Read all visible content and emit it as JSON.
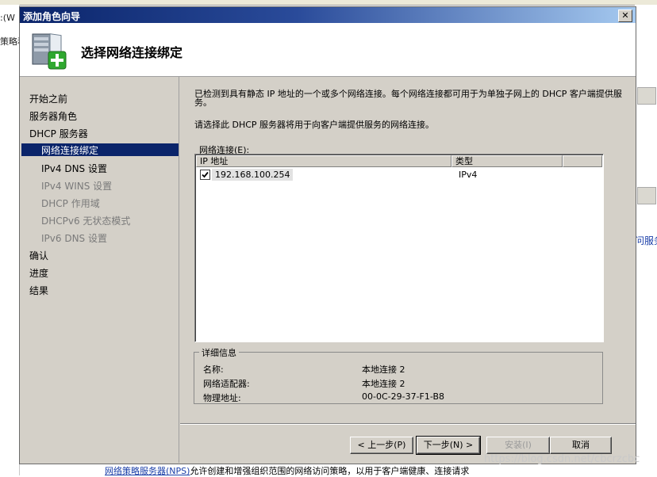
{
  "background": {
    "left_fragments": [
      ":(W",
      "策略和"
    ],
    "right_link_fragment": "问服务",
    "bottom_text_link": "网络策略服务器(NPS)",
    "bottom_text_rest": "允许创建和增强组织范围的网络访问策略，以用于客户端健康、连接请求",
    "watermark": "https://blog.csdn.net/cbcrzcbc"
  },
  "dialog": {
    "title": "添加角色向导",
    "close_glyph": "✕",
    "header_title": "选择网络连接绑定"
  },
  "nav": {
    "items": [
      {
        "label": "开始之前"
      },
      {
        "label": "服务器角色"
      },
      {
        "label": "DHCP 服务器"
      },
      {
        "label": "网络连接绑定"
      },
      {
        "label": "IPv4 DNS 设置"
      },
      {
        "label": "IPv4 WINS 设置"
      },
      {
        "label": "DHCP 作用域"
      },
      {
        "label": "DHCPv6 无状态模式"
      },
      {
        "label": "IPv6 DNS 设置"
      },
      {
        "label": "确认"
      },
      {
        "label": "进度"
      },
      {
        "label": "结果"
      }
    ]
  },
  "content": {
    "description": "已检测到具有静态 IP 地址的一个或多个网络连接。每个网络连接都可用于为单独子网上的 DHCP 客户端提供服务。",
    "instruction": "请选择此 DHCP 服务器将用于向客户端提供服务的网络连接。",
    "list_label": "网络连接(E):",
    "columns": [
      "IP 地址",
      "类型"
    ],
    "rows": [
      {
        "checked": true,
        "ip": "192.168.100.254",
        "type": "IPv4"
      }
    ],
    "details": {
      "legend": "详细信息",
      "name_label": "名称:",
      "name_value": "本地连接 2",
      "adapter_label": "网络适配器:",
      "adapter_value": "本地连接 2",
      "mac_label": "物理地址:",
      "mac_value": "00-0C-29-37-F1-B8"
    }
  },
  "buttons": {
    "prev": "< 上一步(P)",
    "next": "下一步(N) >",
    "install": "安装(I)",
    "cancel": "取消"
  }
}
